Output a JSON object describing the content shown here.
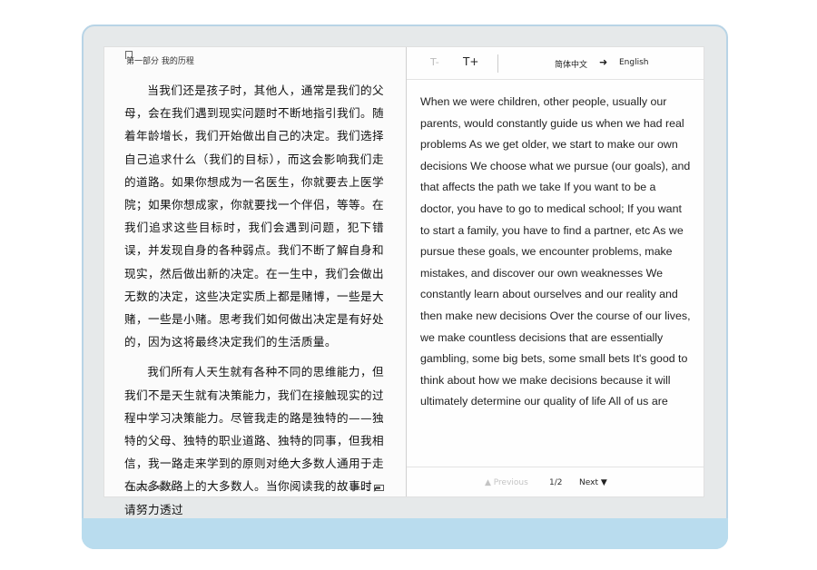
{
  "left_page": {
    "chapter_header": "第一部分 我的历程",
    "paragraphs": [
      "当我们还是孩子时，其他人，通常是我们的父母，会在我们遇到现实问题时不断地指引我们。随着年龄增长，我们开始做出自己的决定。我们选择自己追求什么（我们的目标），而这会影响我们走的道路。如果你想成为一名医生，你就要去上医学院；如果你想成家，你就要找一个伴侣，等等。在我们追求这些目标时，我们会遇到问题，犯下错误，并发现自身的各种弱点。我们不断了解自身和现实，然后做出新的决定。在一生中，我们会做出无数的决定，这些决定实质上都是赌博，一些是大赌，一些是小赌。思考我们如何做出决定是有好处的，因为这将最终决定我们的生活质量。",
      "我们所有人天生就有各种不同的思维能力，但我们不是天生就有决策能力，我们在接触现实的过程中学习决策能力。尽管我走的路是独特的——独特的父母、独特的职业道路、独特的同事，但我相信，我一路走来学到的原则对绝大多数人通用于走在大多数路上的大多数人。当你阅读我的故事时，请努力透过"
    ],
    "chapter_footer": "Chapter 4/47",
    "time": "15:25"
  },
  "right_page": {
    "toolbar": {
      "font_decrease": "T-",
      "font_increase": "T+",
      "lang_from": "简体中文",
      "arrow": "➜",
      "lang_to": "English"
    },
    "translation": "When we were children, other people, usually our parents, would constantly guide us when we had real problems As we get older, we start to make our own decisions We choose what we pursue (our goals), and that affects the path we take If you want to be a doctor, you have to go to medical school; If you want to start a family, you have to find a partner, etc As we pursue these goals, we encounter problems, make mistakes, and discover our own weaknesses We constantly learn about ourselves and our reality and then make new decisions Over the course of our lives, we make countless decisions that are essentially gambling, some big bets, some small bets It's good to think about how we make decisions because it will ultimately determine our quality of life All of us are",
    "pager": {
      "previous": "▲ Previous",
      "page": "1/2",
      "next": "Next ▼"
    }
  },
  "colors": {
    "device_frame": "#e6e9ea",
    "device_border": "#b8d4e6",
    "chin": "#b9dcee",
    "screen": "#fbfbfb"
  }
}
